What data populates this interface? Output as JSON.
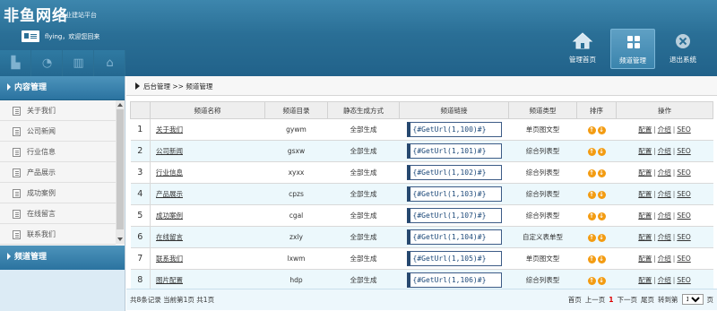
{
  "header": {
    "logo": "非鱼网络",
    "logo_sub": "企业建站平台",
    "welcome": "flying，欢迎您回来"
  },
  "topnav": [
    {
      "label": "管理首页",
      "icon": "home-icon"
    },
    {
      "label": "频道管理",
      "icon": "grid-icon"
    },
    {
      "label": "退出系统",
      "icon": "close-icon"
    }
  ],
  "sidebar": {
    "section1": "内容管理",
    "items": [
      "关于我们",
      "公司新闻",
      "行业信息",
      "产品展示",
      "成功案例",
      "在线留言",
      "联系我们"
    ],
    "section2": "频道管理"
  },
  "breadcrumb": "后台管理 >> 频道管理",
  "table": {
    "headers": [
      "频道名称",
      "频道目录",
      "静态生成方式",
      "频道链接",
      "频道类型",
      "排序",
      "操作"
    ],
    "rows": [
      {
        "num": "1",
        "name": "关于我们",
        "dir": "gywm",
        "gen": "全部生成",
        "link": "{#GetUrl(1,100)#}",
        "type": "单页图文型"
      },
      {
        "num": "2",
        "name": "公司新闻",
        "dir": "gsxw",
        "gen": "全部生成",
        "link": "{#GetUrl(1,101)#}",
        "type": "综合列表型"
      },
      {
        "num": "3",
        "name": "行业信息",
        "dir": "xyxx",
        "gen": "全部生成",
        "link": "{#GetUrl(1,102)#}",
        "type": "综合列表型"
      },
      {
        "num": "4",
        "name": "产品展示",
        "dir": "cpzs",
        "gen": "全部生成",
        "link": "{#GetUrl(1,103)#}",
        "type": "综合列表型"
      },
      {
        "num": "5",
        "name": "成功案例",
        "dir": "cgal",
        "gen": "全部生成",
        "link": "{#GetUrl(1,107)#}",
        "type": "综合列表型"
      },
      {
        "num": "6",
        "name": "在线留言",
        "dir": "zxly",
        "gen": "全部生成",
        "link": "{#GetUrl(1,104)#}",
        "type": "自定义表单型"
      },
      {
        "num": "7",
        "name": "联系我们",
        "dir": "lxwm",
        "gen": "全部生成",
        "link": "{#GetUrl(1,105)#}",
        "type": "单页图文型"
      },
      {
        "num": "8",
        "name": "图片配置",
        "dir": "hdp",
        "gen": "全部生成",
        "link": "{#GetUrl(1,106)#}",
        "type": "综合列表型"
      }
    ],
    "ops": [
      "配置",
      "介绍",
      "SEO"
    ]
  },
  "footer": {
    "summary": "共8条记录 当前第1页 共1页",
    "first": "首页",
    "prev": "上一页",
    "current": "1",
    "next": "下一页",
    "last": "尾页",
    "goto": "转到第",
    "page_select": "1",
    "page_unit": "页"
  }
}
